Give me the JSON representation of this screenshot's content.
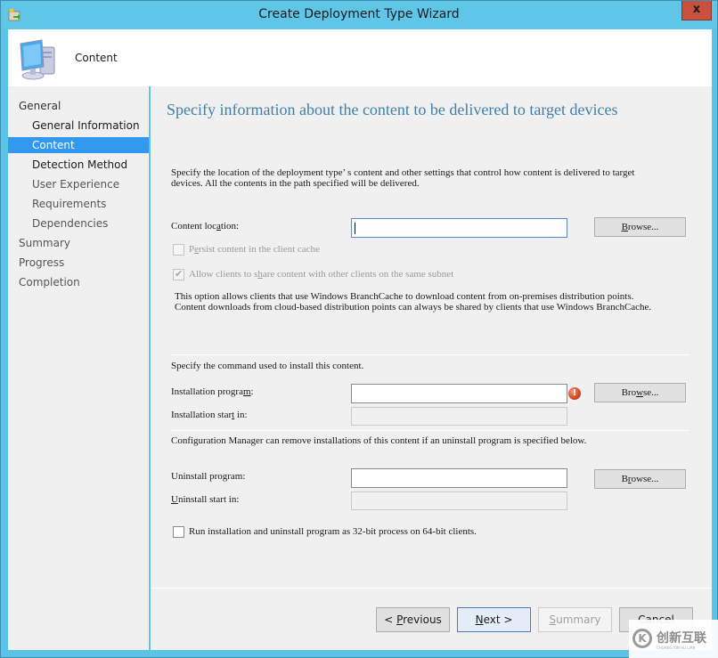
{
  "window": {
    "title": "Create Deployment Type Wizard",
    "close_label": "x",
    "app_icon": "wizard-app-icon"
  },
  "header": {
    "title": "Content",
    "icon": "computer-icon"
  },
  "sidebar": {
    "items": [
      {
        "label": "General",
        "level": 0,
        "state": "normal"
      },
      {
        "label": "General Information",
        "level": 1,
        "state": "normal"
      },
      {
        "label": "Content",
        "level": 1,
        "state": "active"
      },
      {
        "label": "Detection Method",
        "level": 1,
        "state": "normal"
      },
      {
        "label": "User Experience",
        "level": 1,
        "state": "muted"
      },
      {
        "label": "Requirements",
        "level": 1,
        "state": "muted"
      },
      {
        "label": "Dependencies",
        "level": 1,
        "state": "muted"
      },
      {
        "label": "Summary",
        "level": 0,
        "state": "muted"
      },
      {
        "label": "Progress",
        "level": 0,
        "state": "muted"
      },
      {
        "label": "Completion",
        "level": 0,
        "state": "muted"
      }
    ]
  },
  "main": {
    "heading": "Specify information about the content to be delivered to target devices",
    "intro_line1": "Specify the location of the deployment type’ s content and other settings that control how content is delivered to target",
    "intro_line2": "devices. All the contents in the path specified will be delivered.",
    "content_location": {
      "label_pre": "Content loc",
      "label_u": "a",
      "label_post": "tion:",
      "value": "",
      "browse_pre": "",
      "browse_u": "B",
      "browse_post": "rowse..."
    },
    "persist_cache": {
      "label_pre": "P",
      "label_u": "e",
      "label_post": "rsist content in the client cache",
      "checked": false,
      "enabled": false
    },
    "share_content": {
      "label_pre": "Allow clients to s",
      "label_u": "h",
      "label_post": "are content with other clients on the same subnet",
      "checked": true,
      "enabled": false
    },
    "branchcache_note_line1": "This option allows clients that use Windows BranchCache to download content from on-premises distribution points.",
    "branchcache_note_line2": "Content downloads from cloud-based distribution points can always be shared by clients that use Windows BranchCache.",
    "install_section_text": "Specify the command used to install this content.",
    "installation_program": {
      "label_pre": "Installation progra",
      "label_u": "m",
      "label_post": ":",
      "value": "",
      "error": true,
      "browse_pre": "Bro",
      "browse_u": "w",
      "browse_post": "se..."
    },
    "installation_start_in": {
      "label_pre": "Installation star",
      "label_u": "t",
      "label_post": " in:",
      "value": ""
    },
    "uninstall_section_text": "Configuration Manager can remove installations of this content if an uninstall program is specified below.",
    "uninstall_program": {
      "label_pre": "Uninstall pro",
      "label_u": "g",
      "label_post": "ram:",
      "value": "",
      "browse_pre": "B",
      "browse_u": "r",
      "browse_post": "owse..."
    },
    "uninstall_start_in": {
      "label_pre": "",
      "label_u": "U",
      "label_post": "ninstall start in:",
      "value": ""
    },
    "run_32bit": {
      "label": "Run installation and uninstall program as 32-bit process on 64-bit clients.",
      "checked": false
    }
  },
  "footer": {
    "previous": {
      "pre": "< ",
      "u": "P",
      "post": "revious"
    },
    "next": {
      "pre": "",
      "u": "N",
      "post": "ext >"
    },
    "summary": {
      "pre": "",
      "u": "S",
      "post": "ummary"
    },
    "cancel": {
      "label": "Cancel"
    }
  },
  "watermark": {
    "text": "创新互联",
    "sub": "CHUANG XIN HU LIAN"
  }
}
